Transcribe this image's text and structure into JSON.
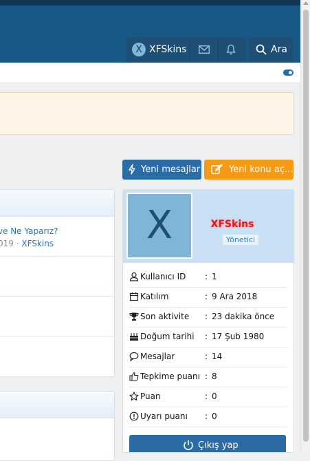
{
  "nav": {
    "username": "XFSkins",
    "avatar_letter": "X",
    "search_label": "Ara"
  },
  "buttons": {
    "new_messages": "Yeni mesajlar",
    "new_topic": "Yeni konu aç..."
  },
  "thread": {
    "title_fragment": "ve Ne Yaparız?",
    "date_fragment": "019 ·",
    "author": "XFSkins"
  },
  "profile": {
    "avatar_letter": "X",
    "name": "XFSkins",
    "role_badge": "Yönetici",
    "stats": [
      {
        "icon": "user-icon",
        "label": "Kullanıcı ID",
        "value": "1"
      },
      {
        "icon": "calendar-icon",
        "label": "Katılım",
        "value": "9 Ara 2018"
      },
      {
        "icon": "trophy-icon",
        "label": "Son aktivite",
        "value": "23 dakika önce"
      },
      {
        "icon": "birthday-cake-icon",
        "label": "Doğum tarihi",
        "value": "17 Şub 1980"
      },
      {
        "icon": "comment-icon",
        "label": "Mesajlar",
        "value": "14"
      },
      {
        "icon": "thumbs-up-icon",
        "label": "Tepkime puanı",
        "value": "8"
      },
      {
        "icon": "star-icon",
        "label": "Puan",
        "value": "0"
      },
      {
        "icon": "warning-icon",
        "label": "Uyarı puanı",
        "value": "0"
      }
    ],
    "logout_label": "Çıkış yap"
  },
  "colors": {
    "header": "#185886",
    "primary_button": "#2c6ca4",
    "accent_button": "#f49a16",
    "username_red": "#e11111"
  }
}
